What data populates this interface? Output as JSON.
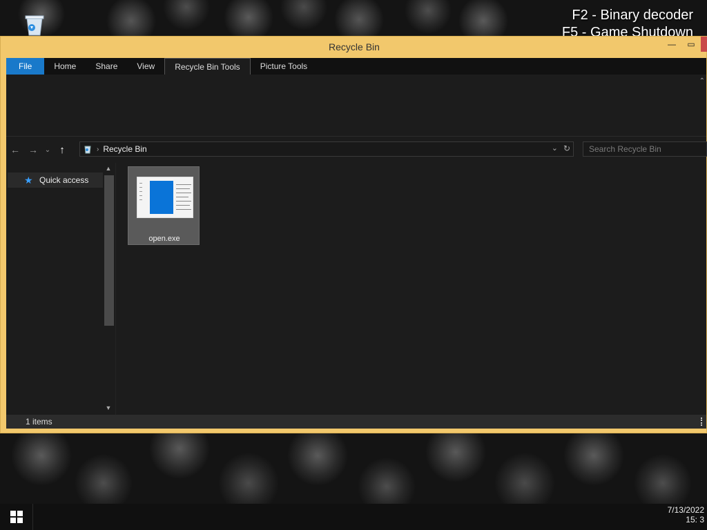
{
  "overlay": {
    "line1": "F2 - Binary decoder",
    "line2": "F5 - Game Shutdown"
  },
  "window": {
    "title": "Recycle Bin",
    "controls": {
      "minimize": "—",
      "maximize": "▭"
    }
  },
  "ribbon": {
    "tabs": [
      {
        "label": "File"
      },
      {
        "label": "Home"
      },
      {
        "label": "Share"
      },
      {
        "label": "View"
      },
      {
        "label": "Recycle Bin Tools"
      },
      {
        "label": "Picture Tools"
      }
    ],
    "collapse_glyph": "⌃"
  },
  "navbar": {
    "back_glyph": "←",
    "forward_glyph": "→",
    "recent_glyph": "⌄",
    "up_glyph": "↑",
    "path_separator": "›",
    "path": "Recycle Bin",
    "dropdown_glyph": "⌄",
    "refresh_glyph": "↻",
    "search_placeholder": "Search Recycle Bin"
  },
  "navpane": {
    "quick_access": "Quick access",
    "star_glyph": "★",
    "scroll_up_glyph": "▲",
    "scroll_down_glyph": "▼"
  },
  "files": [
    {
      "name": "open.exe"
    }
  ],
  "status": {
    "item_count": "1 items"
  },
  "taskbar": {
    "date": "7/13/2022",
    "time": "15: 3"
  },
  "colors": {
    "window_frame": "#f2c86c",
    "file_tab": "#1979ca",
    "quick_access_star": "#3aa0ff",
    "thumb_accent": "#0a74d8"
  }
}
